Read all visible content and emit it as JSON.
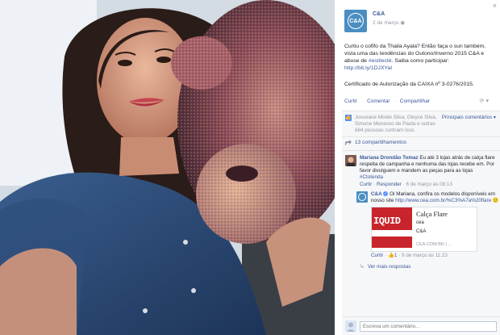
{
  "window": {
    "close_glyph": "×"
  },
  "post": {
    "page_name": "C&A",
    "avatar_text": "C&A",
    "date": "2 de março",
    "privacy_icon": "globe-icon",
    "text_line1": "Curtiu o cofifo da Thaila Ayala? Então faça o sun também, vista uma das tendências do Outono/Inverno 2015 C&A e abuse de",
    "hashtag": "#estilectè",
    "text_line2": ". Saiba como participar:",
    "link": "http://bit.ly/1DJXYaI",
    "certificate": "Certificado de Autorização da CAIXA nº 3-0276/2015.",
    "actions": [
      "Curtir",
      "Comentar",
      "Compartilhar"
    ],
    "share_control": "⟳ ▾"
  },
  "ufi": {
    "likes_text": "Josceane Mirele Silva, Gleyce Silva, Simone Menesso de Paula e outras 684 pessoas curtiram isso.",
    "sort_label": "Principais comentários ▾",
    "shares_text": "13 compartilhamentos",
    "comment": {
      "author": "Mariana Drondão Tomaz",
      "text": " Eu até 3 lojas atrás de calça flare respeita de campanha e nenhuma das lojas recebe em. Por favor divulguem e mandem as peças para as lojas",
      "hashtag": "#Ctotenda",
      "like_label": "Curtir",
      "reply_label": "Responder",
      "time": "6 de março às 08:13"
    },
    "reply": {
      "author": "C&A",
      "verified": "✓",
      "text": " Oi Mariana, confira os modelos disponíveis em nosso site",
      "link": "http://www.cea.com.br/%C3%A7a%20flare",
      "emoji": "🙂",
      "card": {
        "thumb_text": "IQUID",
        "title": "Calça Flare",
        "site": "cea",
        "brand": "C&A",
        "url": "CEA.COM.BR  |  ..."
      },
      "like_label": "Curtir",
      "like_count": "1",
      "time": "9 de março às 11:23"
    },
    "more_replies": "Ver mais respostas"
  },
  "composer": {
    "placeholder": "Escreva um comentário..."
  },
  "colors": {
    "fb_link": "#3b5998",
    "ufi_bg": "#f6f7f9",
    "avatar_blue": "#4a8ec2",
    "card_red": "#c8242b"
  }
}
